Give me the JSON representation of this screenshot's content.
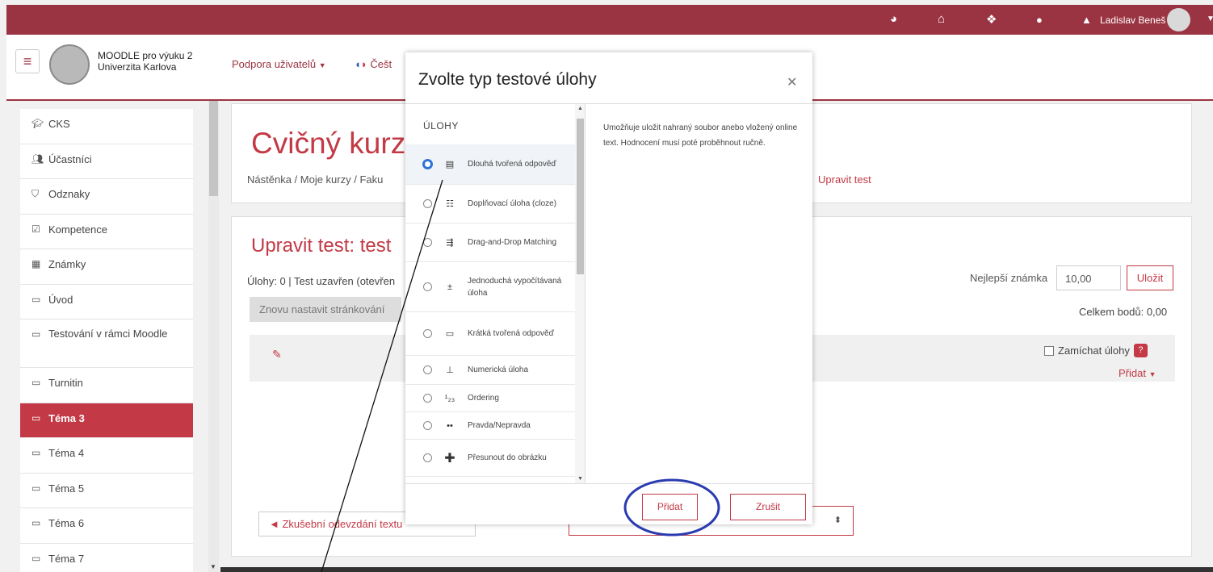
{
  "topbar": {
    "user_name": "Ladislav Beneš",
    "icons": [
      "dashboard-icon",
      "home-icon",
      "courses-icon",
      "chat-icon",
      "bell-icon"
    ]
  },
  "navbar": {
    "brand_line1": "MOODLE pro výuku 2",
    "brand_line2": "Univerzita Karlova",
    "support_label": "Podpora uživatelů",
    "language_label": "Češt"
  },
  "sidebar": {
    "items": [
      {
        "label": "CKS",
        "icon": "graduation-cap-icon"
      },
      {
        "label": "Účastníci",
        "icon": "users-icon"
      },
      {
        "label": "Odznaky",
        "icon": "shield-icon"
      },
      {
        "label": "Kompetence",
        "icon": "checkbox-icon"
      },
      {
        "label": "Známky",
        "icon": "table-icon"
      },
      {
        "label": "Úvod",
        "icon": "folder-icon"
      },
      {
        "label": "Testování v rámci Moodle",
        "icon": "folder-icon"
      },
      {
        "label": "Turnitin",
        "icon": "folder-icon"
      },
      {
        "label": "Téma 3",
        "icon": "folder-icon"
      },
      {
        "label": "Téma 4",
        "icon": "folder-icon"
      },
      {
        "label": "Téma 5",
        "icon": "folder-icon"
      },
      {
        "label": "Téma 6",
        "icon": "folder-icon"
      },
      {
        "label": "Téma 7",
        "icon": "folder-icon"
      }
    ]
  },
  "course": {
    "title": "Cvičný kurz p",
    "breadcrumb": "Nástěnka / Moje kurzy / Faku",
    "breadcrumb_end": "Upravit test"
  },
  "quiz": {
    "title": "Upravit test: test",
    "info": "Úlohy: 0 | Test uzavřen (otevřen",
    "repaginate_label": "Znovu nastavit stránkování",
    "best_grade_label": "Nejlepší známka",
    "best_grade_value": "10,00",
    "save_label": "Uložit",
    "total_points": "Celkem bodů: 0,00",
    "shuffle_label": "Zamíchat úlohy",
    "add_label": "Přidat",
    "prev_activity_label": "◄ Zkušební odevzdání textu"
  },
  "modal": {
    "title": "Zvolte typ testové úlohy",
    "section_header": "ÚLOHY",
    "options": [
      {
        "label": "Dlouhá tvořená odpověď",
        "icon": "essay-icon"
      },
      {
        "label": "Doplňovací úloha (cloze)",
        "icon": "cloze-icon"
      },
      {
        "label": "Drag-and-Drop Matching",
        "icon": "drag-drop-matching-icon"
      },
      {
        "label": "Jednoduchá vypočítávaná úloha",
        "icon": "calculated-simple-icon"
      },
      {
        "label": "Krátká tvořená odpověď",
        "icon": "short-answer-icon"
      },
      {
        "label": "Numerická úloha",
        "icon": "numerical-icon"
      },
      {
        "label": "Ordering",
        "icon": "ordering-icon"
      },
      {
        "label": "Pravda/Nepravda",
        "icon": "true-false-icon"
      },
      {
        "label": "Přesunout do obrázku",
        "icon": "drag-to-image-icon"
      }
    ],
    "description": "Umožňuje uložit nahraný soubor anebo vložený online text. Hodnocení musí poté proběhnout ručně.",
    "add_button": "Přidat",
    "cancel_button": "Zrušit"
  },
  "colors": {
    "brand": "#9b3442",
    "accent": "#c33945",
    "annotation": "#2a3bb0"
  }
}
